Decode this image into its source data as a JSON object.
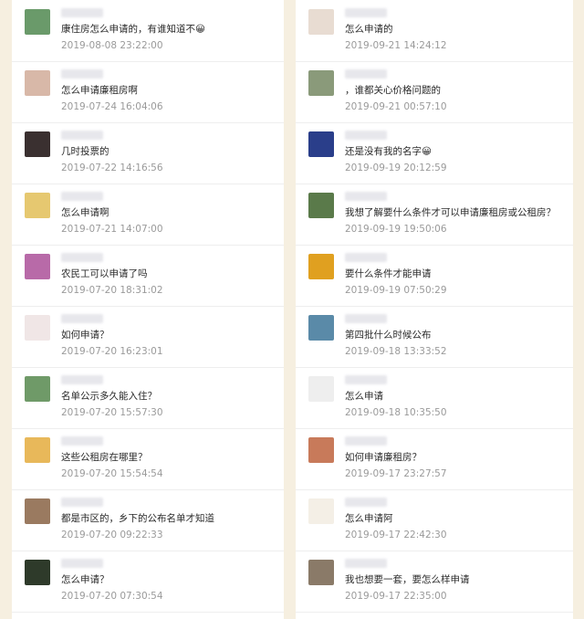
{
  "left_comments": [
    {
      "text": "康住房怎么申请的，有谁知道不😀",
      "time": "2019-08-08 23:22:00",
      "avatar": "#6a9a6a"
    },
    {
      "text": "怎么申请廉租房啊",
      "time": "2019-07-24 16:04:06",
      "avatar": "#d8b8a8"
    },
    {
      "text": "几时投票的",
      "time": "2019-07-22 14:16:56",
      "avatar": "#3a3030"
    },
    {
      "text": "怎么申请啊",
      "time": "2019-07-21 14:07:00",
      "avatar": "#e6c870"
    },
    {
      "text": "农民工可以申请了吗",
      "time": "2019-07-20 18:31:02",
      "avatar": "#b86aa8"
    },
    {
      "text": "如何申请？",
      "time": "2019-07-20 16:23:01",
      "avatar": "#f0e6e6"
    },
    {
      "text": "名单公示多久能入住？",
      "time": "2019-07-20 15:57:30",
      "avatar": "#6f9a68"
    },
    {
      "text": "这些公租房在哪里？",
      "time": "2019-07-20 15:54:54",
      "avatar": "#e8b85a"
    },
    {
      "text": "都是市区的，乡下的公布名单才知道",
      "time": "2019-07-20 09:22:33",
      "avatar": "#9a7a60"
    },
    {
      "text": "怎么申请？",
      "time": "2019-07-20 07:30:54",
      "avatar": "#2e3a2a"
    }
  ],
  "right_comments": [
    {
      "text": "怎么申请的",
      "time": "2019-09-21 14:24:12",
      "avatar": "#e8dcd2"
    },
    {
      "text": "，谁都关心价格问题的",
      "time": "2019-09-21 00:57:10",
      "avatar": "#8a9a7a"
    },
    {
      "text": "还是没有我的名字😀",
      "time": "2019-09-19 20:12:59",
      "avatar": "#2a3e8a"
    },
    {
      "text": "我想了解要什么条件才可以申请廉租房或公租房？",
      "time": "2019-09-19 19:50:06",
      "avatar": "#5a7a4a"
    },
    {
      "text": "要什么条件才能申请",
      "time": "2019-09-19 07:50:29",
      "avatar": "#e0a020"
    },
    {
      "text": "第四批什么时候公布",
      "time": "2019-09-18 13:33:52",
      "avatar": "#5a8aa8"
    },
    {
      "text": "怎么申请",
      "time": "2019-09-18 10:35:50",
      "avatar": "#eeeeee"
    },
    {
      "text": "如何申请廉租房？",
      "time": "2019-09-17 23:27:57",
      "avatar": "#c87a5a"
    },
    {
      "text": "怎么申请阿",
      "time": "2019-09-17 22:42:30",
      "avatar": "#f4efe6"
    },
    {
      "text": "我也想要一套，要怎么样申请",
      "time": "2019-09-17 22:35:00",
      "avatar": "#8a7a68"
    }
  ]
}
